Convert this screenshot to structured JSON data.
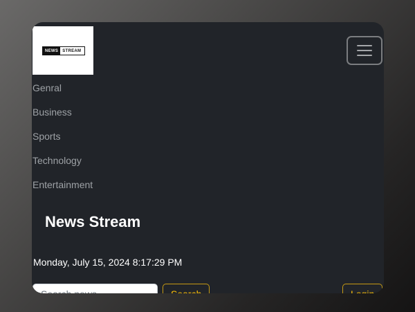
{
  "header": {
    "logo": {
      "part1": "NEWS",
      "part2": "STREAM"
    },
    "toggler_icon": "hamburger-menu-icon"
  },
  "nav": {
    "items": [
      {
        "label": "Genral"
      },
      {
        "label": "Business"
      },
      {
        "label": "Sports"
      },
      {
        "label": "Technology"
      },
      {
        "label": "Entertainment"
      }
    ]
  },
  "brand": {
    "title": "News Stream"
  },
  "clock": {
    "datetime": "Monday, July 15, 2024 8:17:29 PM"
  },
  "search": {
    "placeholder": "Search news",
    "button_label": "Search"
  },
  "auth": {
    "login_label": "Login"
  },
  "colors": {
    "background": "#212429",
    "accent": "#ffc107",
    "nav_text": "#9ea2a6",
    "text": "#ffffff"
  }
}
